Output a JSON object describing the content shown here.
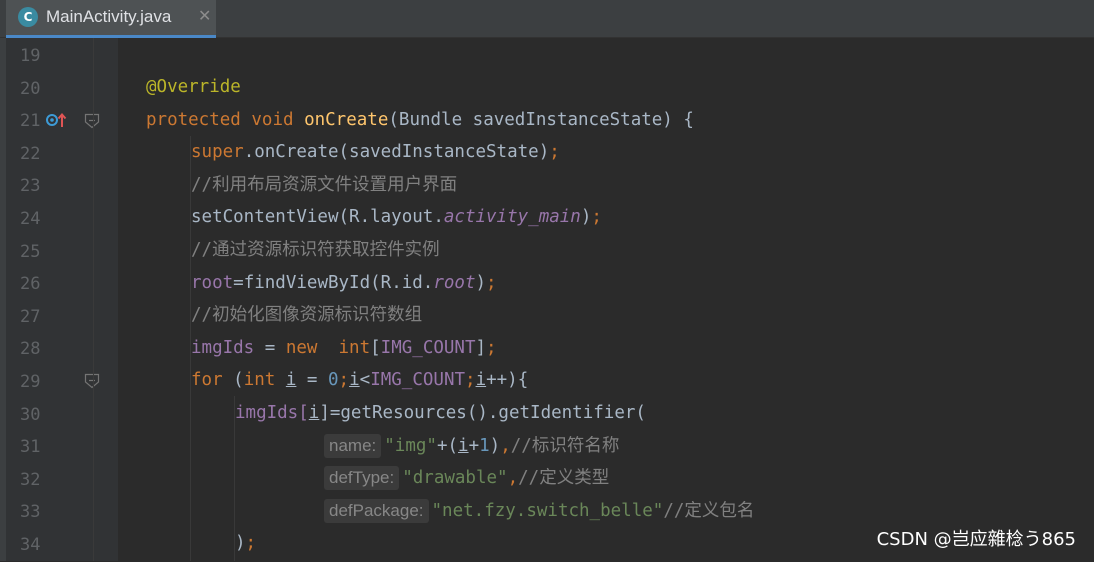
{
  "tab": {
    "icon_letter": "C",
    "icon_name": "java-class-icon",
    "title": "MainActivity.java",
    "close": "✕"
  },
  "gutter": {
    "line_numbers": [
      "19",
      "20",
      "21",
      "22",
      "23",
      "24",
      "25",
      "26",
      "27",
      "28",
      "29",
      "30",
      "31",
      "32",
      "33",
      "34"
    ]
  },
  "code": {
    "l20": {
      "ann": "@Override"
    },
    "l21": {
      "kw1": "protected",
      "kw2": "void",
      "fn": "onCreate",
      "rest": "(Bundle savedInstanceState) {"
    },
    "l22": {
      "kw": "super",
      "rest": ".onCreate(savedInstanceState)",
      "semi": ";"
    },
    "l23": {
      "cmt": "//利用布局资源文件设置用户界面"
    },
    "l24": {
      "a": "setContentView(R.layout.",
      "ita": "activity_main",
      "b": ")",
      "semi": ";"
    },
    "l25": {
      "cmt": "//通过资源标识符获取控件实例"
    },
    "l26": {
      "fld": "root",
      "a": "=findViewById(R.id.",
      "ita": "root",
      "b": ")",
      "semi": ";"
    },
    "l27": {
      "cmt": "//初始化图像资源标识符数组"
    },
    "l28": {
      "fld": "imgIds",
      "a": " = ",
      "kw1": "new",
      "sp": "  ",
      "kw2": "int",
      "b": "[",
      "fld2": "IMG_COUNT",
      "c": "]",
      "semi": ";"
    },
    "l29": {
      "kw1": "for",
      "a": " (",
      "kw2": "int",
      "b": " ",
      "v1": "i",
      "c": " = ",
      "num": "0",
      "semi1": ";",
      "v2": "i",
      "d": "<",
      "fld": "IMG_COUNT",
      "semi2": ";",
      "v3": "i",
      "e": "++){"
    },
    "l30": {
      "fld": "imgIds",
      "a": "[",
      "v": "i",
      "b": "]=getResources().getIdentifier("
    },
    "l31": {
      "hint": "name:",
      "str": "\"img\"",
      "a": "+(",
      "v": "i",
      "b": "+",
      "num": "1",
      "c": ")",
      "comma": ",",
      "cmt": "//标识符名称"
    },
    "l32": {
      "hint": "defType:",
      "str": "\"drawable\"",
      "comma": ",",
      "cmt": "//定义类型"
    },
    "l33": {
      "hint": "defPackage:",
      "str": "\"net.fzy.switch_belle\"",
      "cmt": "//定义包名"
    },
    "l34": {
      "a": ")",
      "semi": ";"
    }
  },
  "watermark": "CSDN @岂应雜棯う865",
  "colors": {
    "background": "#2b2b2b",
    "keyword": "#cc7832",
    "method": "#ffc66d",
    "field": "#9876aa",
    "string": "#6a8759",
    "number": "#6897bb",
    "comment": "#808080",
    "annotation": "#bbb529",
    "tab_underline": "#4a88c7"
  }
}
